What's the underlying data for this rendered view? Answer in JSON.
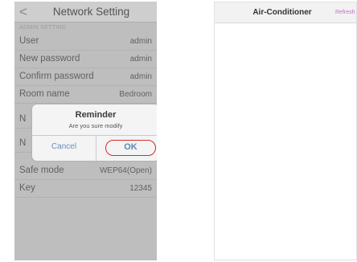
{
  "left_screen": {
    "nav": {
      "back_glyph": "<",
      "title": "Network Setting"
    },
    "section_header": "ADMIN SETTING",
    "rows": [
      {
        "label": "User",
        "value": "admin"
      },
      {
        "label": "New password",
        "value": "admin"
      },
      {
        "label": "Confirm password",
        "value": "admin"
      },
      {
        "label": "Room name",
        "value": "Bedroom"
      },
      {
        "label": "N",
        "value": ""
      },
      {
        "label": "N",
        "value": ""
      },
      {
        "label": "Safe mode",
        "value": "WEP64(Open)"
      },
      {
        "label": "Key",
        "value": "12345"
      }
    ],
    "dialog": {
      "title": "Reminder",
      "message": "Are you sure modify",
      "cancel_label": "Cancel",
      "ok_label": "OK"
    }
  },
  "right_screen": {
    "nav": {
      "title": "Air-Conditioner",
      "refresh_label": "Refresh"
    }
  },
  "colors": {
    "dialog_button_text": "#5f87b3",
    "ok_highlight_ring": "#d62b2b",
    "refresh_text": "#c270c7"
  }
}
